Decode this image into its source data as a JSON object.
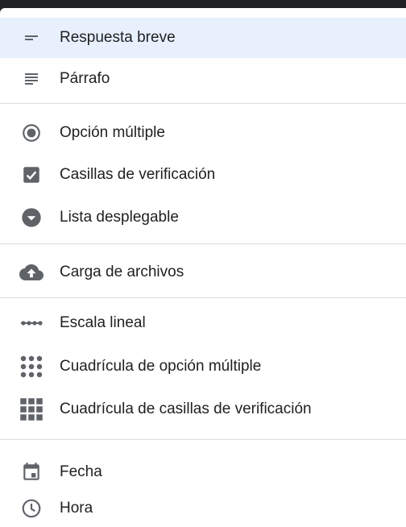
{
  "menu": {
    "items": [
      {
        "label": "Respuesta breve",
        "icon": "short-answer-icon",
        "selected": true
      },
      {
        "label": "Párrafo",
        "icon": "paragraph-icon"
      },
      {
        "label": "Opción múltiple",
        "icon": "radio-button-icon"
      },
      {
        "label": "Casillas de verificación",
        "icon": "checkbox-icon"
      },
      {
        "label": "Lista desplegable",
        "icon": "dropdown-icon"
      },
      {
        "label": "Carga de archivos",
        "icon": "cloud-upload-icon"
      },
      {
        "label": "Escala lineal",
        "icon": "linear-scale-icon"
      },
      {
        "label": "Cuadrícula de opción múltiple",
        "icon": "dot-grid-icon"
      },
      {
        "label": "Cuadrícula de casillas de verificación",
        "icon": "square-grid-icon"
      },
      {
        "label": "Fecha",
        "icon": "calendar-icon"
      },
      {
        "label": "Hora",
        "icon": "clock-icon"
      }
    ]
  },
  "colors": {
    "selected_background": "#e8f0fe",
    "icon": "#5f6368",
    "text": "#202124",
    "divider": "#dadce0"
  }
}
